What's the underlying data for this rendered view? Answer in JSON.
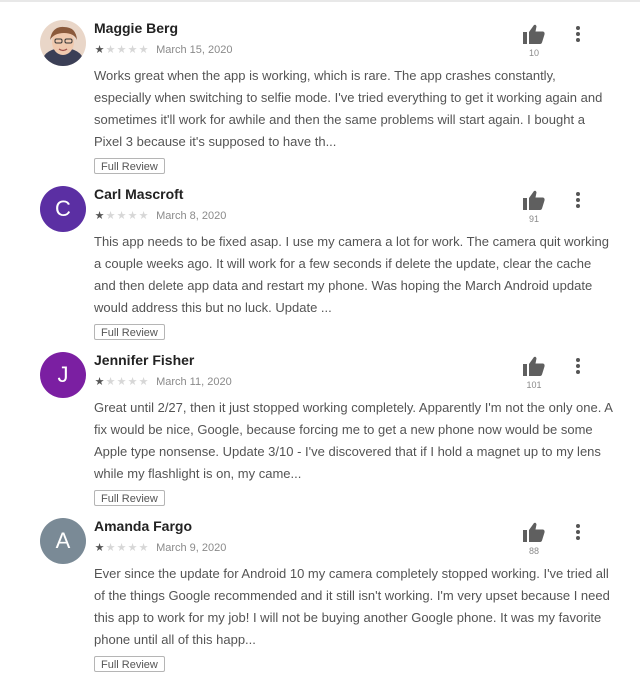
{
  "colors": {
    "accent_purple": "#5b2fa3",
    "avatar_gray": "#7a8a96",
    "star_on": "#555555",
    "star_off": "#d7d7d7"
  },
  "reviews": [
    {
      "name": "Maggie Berg",
      "avatar_type": "photo",
      "avatar_letter": "",
      "avatar_color": "",
      "stars": 1,
      "date": "March 15, 2020",
      "text": "Works great when the app is working, which is rare. The app crashes constantly, especially when switching to selfie mode. I've tried everything to get it working again and sometimes it'll work for awhile and then the same problems will start again. I bought a Pixel 3 because it's supposed to have th...",
      "full_review_label": "Full Review",
      "helpful_count": "10",
      "thumb_icon": "thumbs-up-icon",
      "menu_icon": "more-vert-icon"
    },
    {
      "name": "Carl Mascroft",
      "avatar_type": "letter",
      "avatar_letter": "C",
      "avatar_color": "#5b2fa3",
      "stars": 1,
      "date": "March 8, 2020",
      "text": "This app needs to be fixed asap. I use my camera a lot for work. The camera quit working a couple weeks ago. It will work for a few seconds if delete the update, clear the cache and then delete app data and restart my phone. Was hoping the March Android update would address this but no luck. Update ...",
      "full_review_label": "Full Review",
      "helpful_count": "91",
      "thumb_icon": "thumbs-up-icon",
      "menu_icon": "more-vert-icon"
    },
    {
      "name": "Jennifer Fisher",
      "avatar_type": "letter",
      "avatar_letter": "J",
      "avatar_color": "#7b1fa2",
      "stars": 1,
      "date": "March 11, 2020",
      "text": "Great until 2/27, then it just stopped working completely. Apparently I'm not the only one. A fix would be nice, Google, because forcing me to get a new phone now would be some Apple type nonsense. Update 3/10 - I've discovered that if I hold a magnet up to my lens while my flashlight is on, my came...",
      "full_review_label": "Full Review",
      "helpful_count": "101",
      "thumb_icon": "thumbs-up-icon",
      "menu_icon": "more-vert-icon"
    },
    {
      "name": "Amanda Fargo",
      "avatar_type": "letter",
      "avatar_letter": "A",
      "avatar_color": "#7a8a96",
      "stars": 1,
      "date": "March 9, 2020",
      "text": "Ever since the update for Android 10 my camera completely stopped working. I've tried all of the things Google recommended and it still isn't working. I'm very upset because I need this app to work for my job! I will not be buying another Google phone. It was my favorite phone until all of this happ...",
      "full_review_label": "Full Review",
      "helpful_count": "88",
      "thumb_icon": "thumbs-up-icon",
      "menu_icon": "more-vert-icon"
    }
  ]
}
